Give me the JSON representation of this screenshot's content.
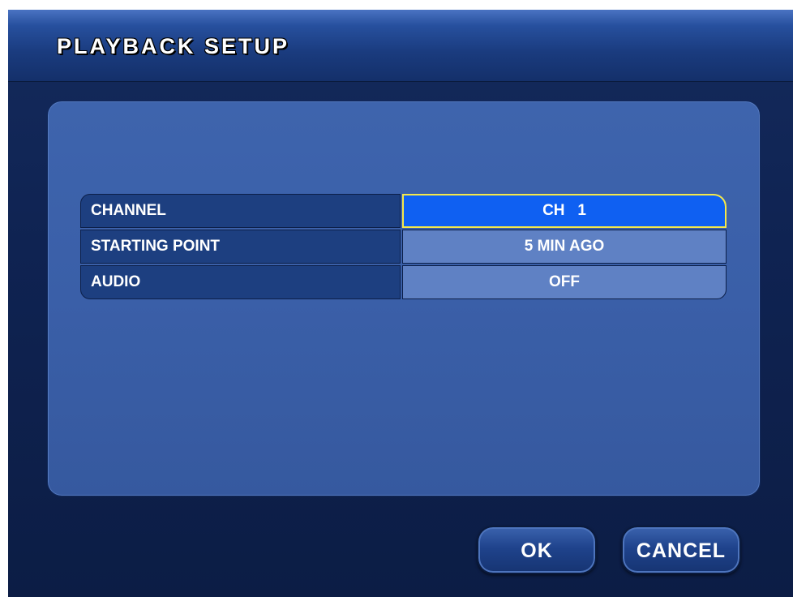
{
  "dialog": {
    "title": "PLAYBACK SETUP"
  },
  "settings": [
    {
      "label": "CHANNEL",
      "value": "CH   1",
      "selected": true
    },
    {
      "label": "STARTING POINT",
      "value": "5 MIN AGO",
      "selected": false
    },
    {
      "label": "AUDIO",
      "value": "OFF",
      "selected": false
    }
  ],
  "buttons": {
    "ok_label": "OK",
    "cancel_label": "CANCEL"
  },
  "colors": {
    "selection_highlight": "#0f60f2",
    "selection_border": "#f5e84a",
    "panel": "#3e64ad"
  }
}
